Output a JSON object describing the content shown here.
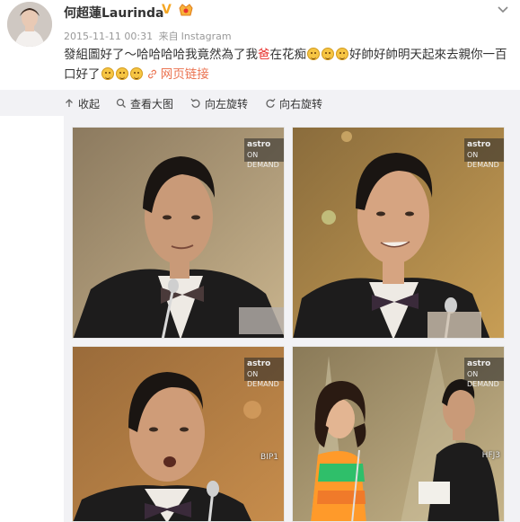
{
  "user": {
    "name": "何超蓮Laurinda",
    "verified_badge": "V",
    "avatar_icon": "avatar-photo"
  },
  "meta": {
    "timestamp": "2015-11-11 00:31",
    "source_prefix": "来自",
    "source": "Instagram"
  },
  "post": {
    "text_part1": "發組圖好了～哈哈哈哈我竟然為了我",
    "text_red": "爸",
    "text_part2": "在花痴",
    "text_part3": "好帥好帥明天起來去親你一百口好了",
    "link_label": "网页链接",
    "emoticons": [
      "cry-laugh",
      "cry-laugh",
      "cry-laugh",
      "cry-laugh",
      "cry-laugh"
    ]
  },
  "toolbar": {
    "collapse": "收起",
    "view_large": "查看大图",
    "rotate_left": "向左旋转",
    "rotate_right": "向右旋转"
  },
  "gallery": {
    "watermark_brand": "astro",
    "watermark_sub": "ON DEMAND",
    "codes": [
      "BIP1",
      "HFJ3"
    ]
  },
  "colors": {
    "accent_link": "#eb7350",
    "highlight_red": "#e8322e",
    "toolbar_bg": "#f2f2f5",
    "verified": "#f5a623"
  }
}
